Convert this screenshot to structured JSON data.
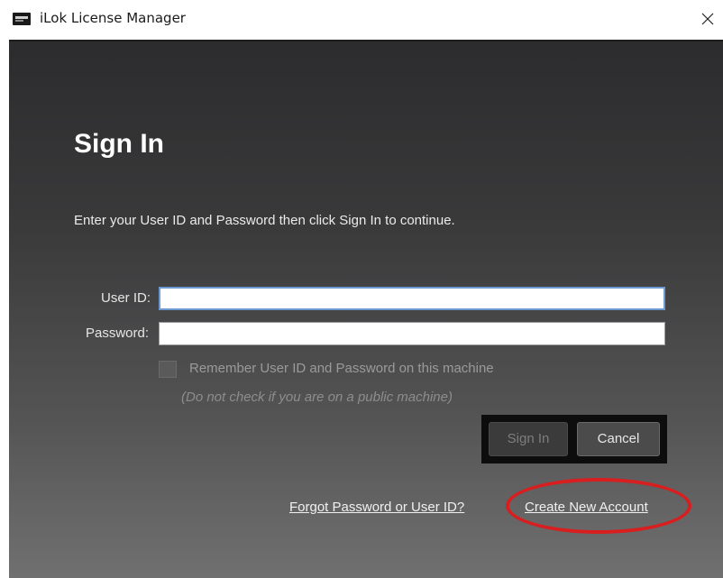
{
  "window": {
    "title": "iLok License Manager",
    "icon": "ilok-app-icon",
    "close_glyph": "✕"
  },
  "signin": {
    "heading": "Sign In",
    "instructions": "Enter your User ID and Password then click Sign In to continue.",
    "user_id_label": "User ID:",
    "user_id_value": "",
    "password_label": "Password:",
    "password_value": "",
    "remember_label": "Remember User ID and Password on this machine",
    "remember_checked": false,
    "remember_hint": "(Do not check if you are on a public machine)",
    "signin_button": "Sign In",
    "cancel_button": "Cancel",
    "forgot_link": "Forgot Password or User ID?",
    "create_link": "Create New Account"
  },
  "colors": {
    "annotation": "#d81e1e",
    "focus_border": "#6c9ad0"
  }
}
